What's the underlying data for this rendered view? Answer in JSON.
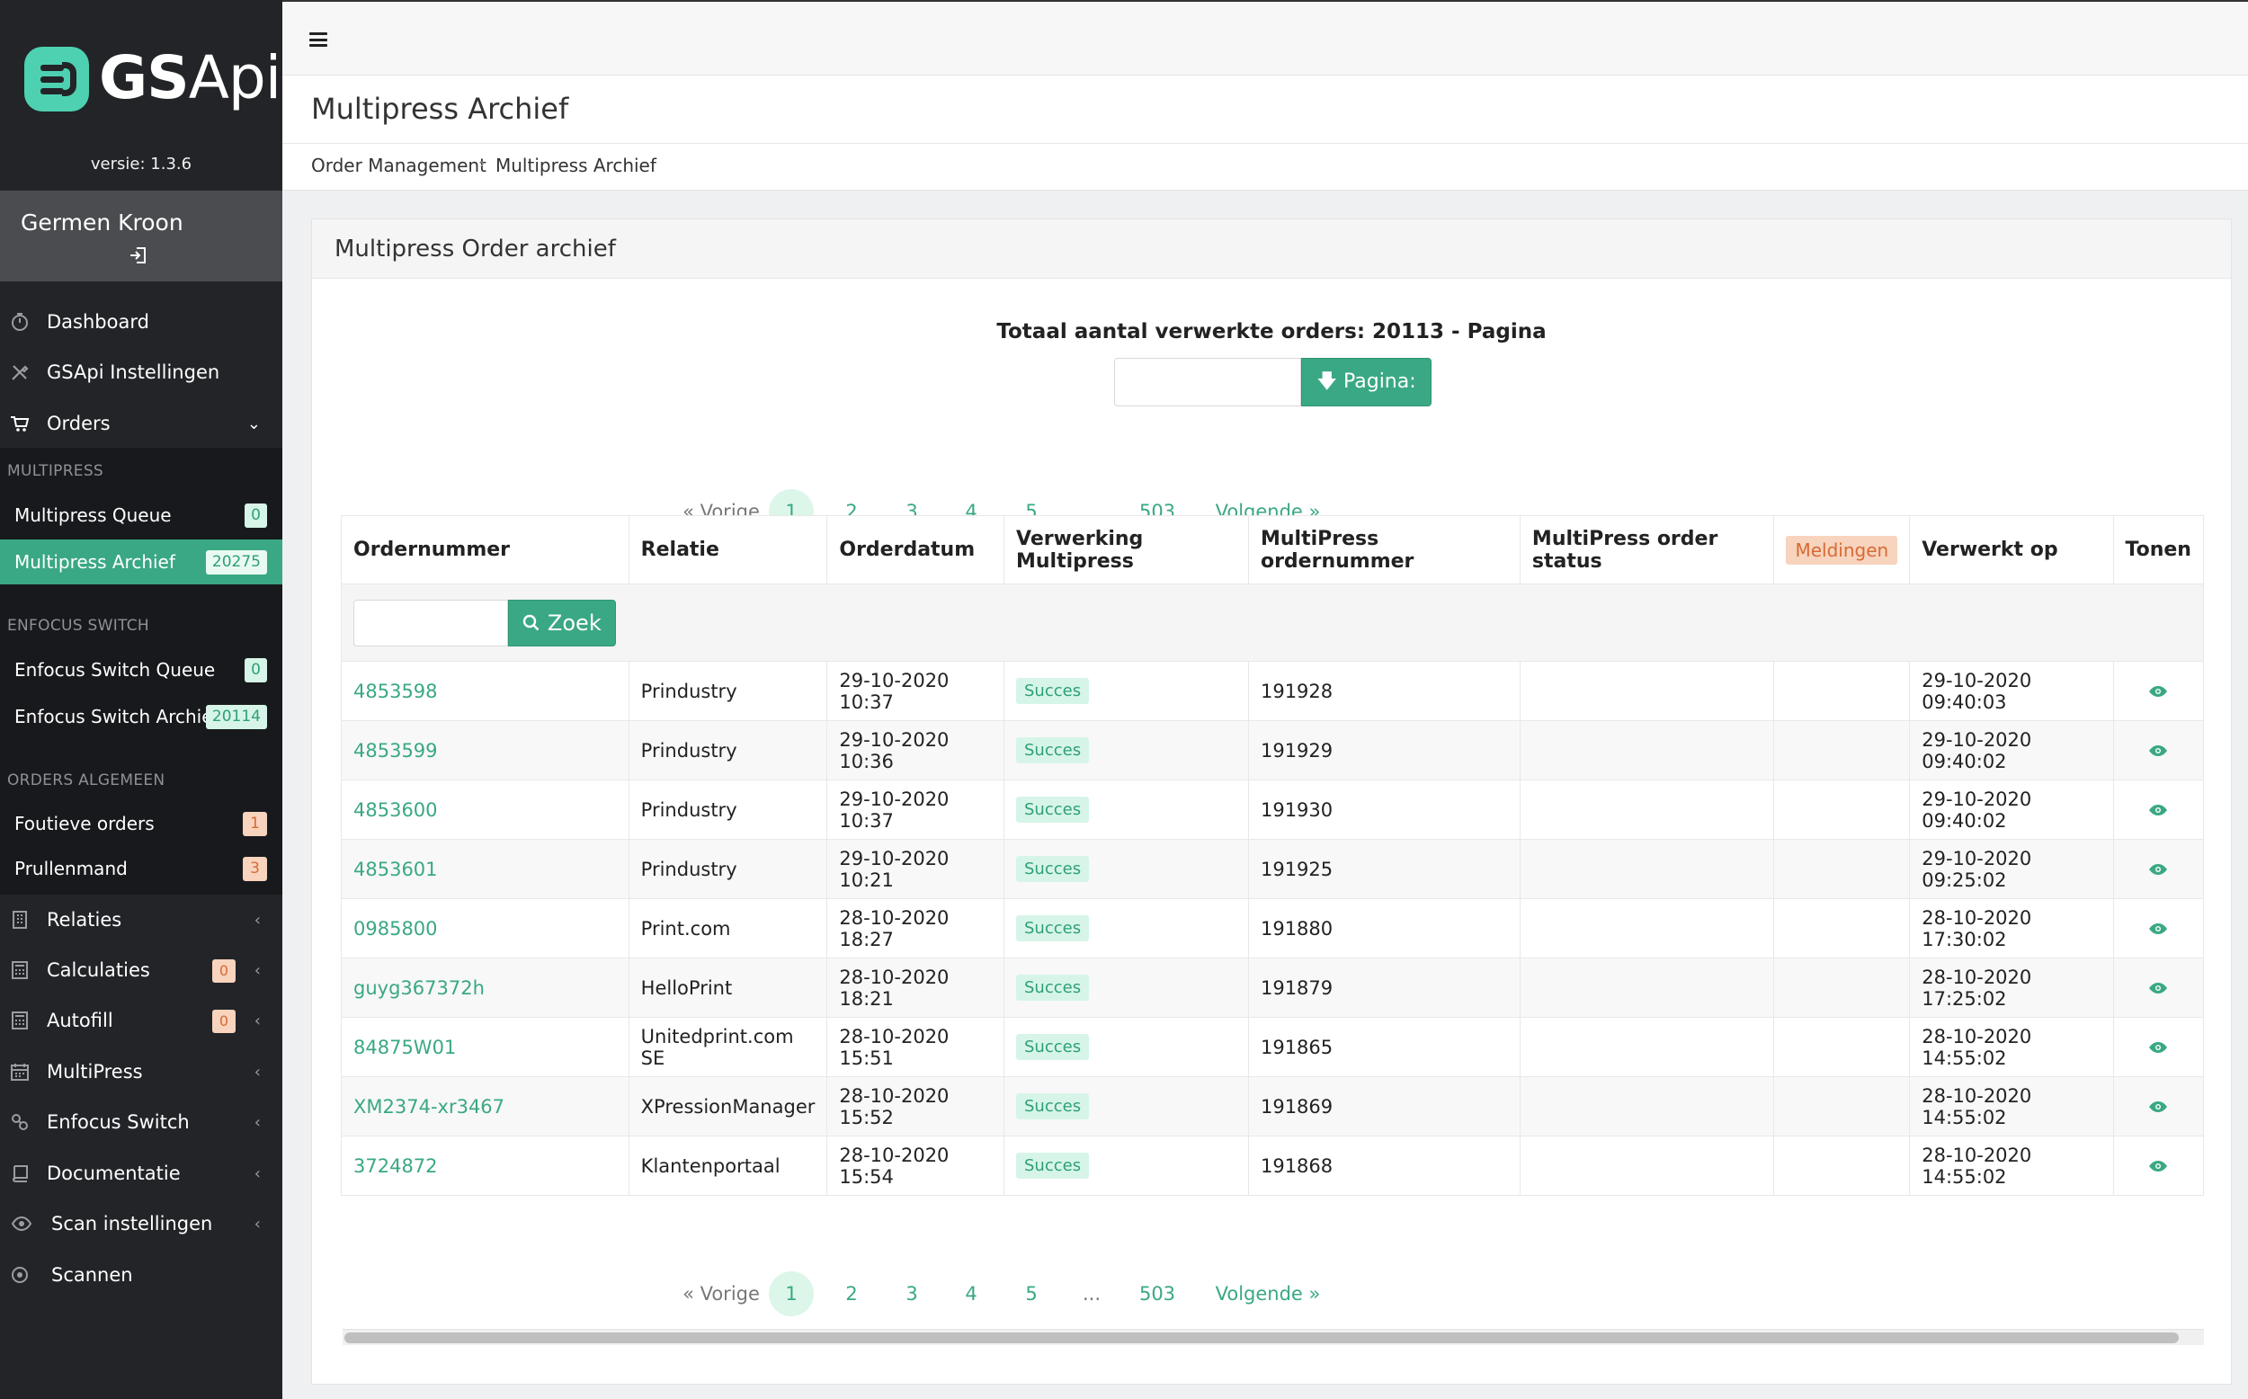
{
  "brand": {
    "name_bold": "GS",
    "name_rest": "Api",
    "version": "versie: 1.3.6"
  },
  "user": {
    "name": "Germen Kroon"
  },
  "sidebar": {
    "top_items": [
      {
        "label": "Dashboard",
        "icon": "dashboard-icon"
      },
      {
        "label": "GSApi Instellingen",
        "icon": "tools-icon"
      },
      {
        "label": "Orders",
        "icon": "cart-icon",
        "chevron": "⌄"
      }
    ],
    "multipress": {
      "heading": "MULTIPRESS",
      "items": [
        {
          "label": "Multipress Queue",
          "count": "0"
        },
        {
          "label": "Multipress Archief",
          "count": "20275"
        }
      ]
    },
    "enfocus": {
      "heading": "ENFOCUS SWITCH",
      "items": [
        {
          "label": "Enfocus Switch Queue",
          "count": "0"
        },
        {
          "label": "Enfocus Switch Archief",
          "count": "20114"
        }
      ]
    },
    "orders_algemeen": {
      "heading": "ORDERS ALGEMEEN",
      "items": [
        {
          "label": "Foutieve orders",
          "count": "1"
        },
        {
          "label": "Prullenmand",
          "count": "3"
        }
      ]
    },
    "bottom_items": [
      {
        "label": "Relaties",
        "icon": "building-icon",
        "chevron": "‹"
      },
      {
        "label": "Calculaties",
        "icon": "calculator-icon",
        "count": "0",
        "chevron": "‹"
      },
      {
        "label": "Autofill",
        "icon": "calculator-icon",
        "count": "0",
        "chevron": "‹"
      },
      {
        "label": "MultiPress",
        "icon": "calendar-icon",
        "chevron": "‹"
      },
      {
        "label": "Enfocus Switch",
        "icon": "link-icon",
        "chevron": "‹"
      },
      {
        "label": "Documentatie",
        "icon": "book-icon",
        "chevron": "‹"
      },
      {
        "label": "Scan instellingen",
        "icon": "eye-icon",
        "chevron": "‹"
      },
      {
        "label": "Scannen",
        "icon": "dot-circle-icon"
      }
    ]
  },
  "header": {
    "page_title": "Multipress Archief",
    "breadcrumb": [
      "Order Management",
      "Multipress Archief"
    ],
    "breadcrumb_sep": "›"
  },
  "card": {
    "title": "Multipress Order archief",
    "total_text": "Totaal aantal verwerkte orders: 20113 - Pagina",
    "page_button": "Pagina:",
    "page_input_value": ""
  },
  "pagination": {
    "prev": "« Vorige",
    "pages": [
      "1",
      "2",
      "3",
      "4",
      "5"
    ],
    "ellipsis": "...",
    "last": "503",
    "next": "Volgende »",
    "current": "1"
  },
  "table": {
    "columns": [
      "Ordernummer",
      "Relatie",
      "Orderdatum",
      "Verwerking Multipress",
      "MultiPress ordernummer",
      "MultiPress order status",
      "Meldingen",
      "Verwerkt op",
      "Tonen"
    ],
    "search_button": "Zoek",
    "search_value": "",
    "rows": [
      {
        "order": "4853598",
        "relatie": "Prindustry",
        "datum": "29-10-2020 10:37",
        "status": "Succes",
        "mp_nr": "191928",
        "mp_status": "",
        "meldingen": "",
        "verwerkt": "29-10-2020 09:40:03"
      },
      {
        "order": "4853599",
        "relatie": "Prindustry",
        "datum": "29-10-2020 10:36",
        "status": "Succes",
        "mp_nr": "191929",
        "mp_status": "",
        "meldingen": "",
        "verwerkt": "29-10-2020 09:40:02"
      },
      {
        "order": "4853600",
        "relatie": "Prindustry",
        "datum": "29-10-2020 10:37",
        "status": "Succes",
        "mp_nr": "191930",
        "mp_status": "",
        "meldingen": "",
        "verwerkt": "29-10-2020 09:40:02"
      },
      {
        "order": "4853601",
        "relatie": "Prindustry",
        "datum": "29-10-2020 10:21",
        "status": "Succes",
        "mp_nr": "191925",
        "mp_status": "",
        "meldingen": "",
        "verwerkt": "29-10-2020 09:25:02"
      },
      {
        "order": "0985800",
        "relatie": "Print.com",
        "datum": "28-10-2020 18:27",
        "status": "Succes",
        "mp_nr": "191880",
        "mp_status": "",
        "meldingen": "",
        "verwerkt": "28-10-2020 17:30:02"
      },
      {
        "order": "guyg367372h",
        "relatie": "HelloPrint",
        "datum": "28-10-2020 18:21",
        "status": "Succes",
        "mp_nr": "191879",
        "mp_status": "",
        "meldingen": "",
        "verwerkt": "28-10-2020 17:25:02"
      },
      {
        "order": "84875W01",
        "relatie": "Unitedprint.com SE",
        "datum": "28-10-2020 15:51",
        "status": "Succes",
        "mp_nr": "191865",
        "mp_status": "",
        "meldingen": "",
        "verwerkt": "28-10-2020 14:55:02"
      },
      {
        "order": "XM2374-xr3467",
        "relatie": "XPressionManager",
        "datum": "28-10-2020 15:52",
        "status": "Succes",
        "mp_nr": "191869",
        "mp_status": "",
        "meldingen": "",
        "verwerkt": "28-10-2020 14:55:02"
      },
      {
        "order": "3724872",
        "relatie": "Klantenportaal",
        "datum": "28-10-2020 15:54",
        "status": "Succes",
        "mp_nr": "191868",
        "mp_status": "",
        "meldingen": "",
        "verwerkt": "28-10-2020 14:55:02"
      }
    ]
  },
  "colors": {
    "accent": "#3aa884",
    "sidebar_bg": "#222428",
    "badge_orange": "#f8d3bd",
    "badge_green": "#d6f5e8"
  }
}
